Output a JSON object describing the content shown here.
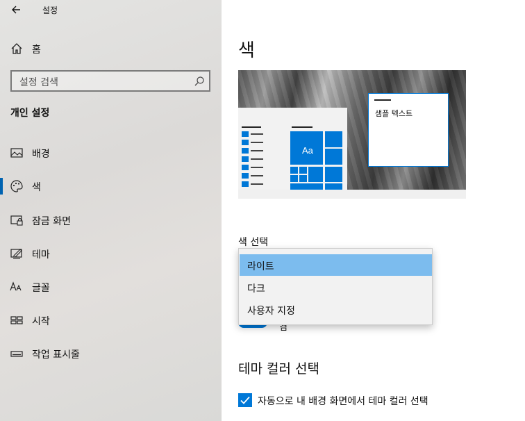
{
  "window": {
    "title": "설정",
    "back_icon": "arrow-left-icon"
  },
  "sidebar": {
    "home_label": "홈",
    "search_placeholder": "설정 검색",
    "section_title": "개인 설정",
    "items": [
      {
        "label": "배경",
        "icon": "picture-icon"
      },
      {
        "label": "색",
        "icon": "palette-icon",
        "active": true
      },
      {
        "label": "잠금 화면",
        "icon": "lock-screen-icon"
      },
      {
        "label": "테마",
        "icon": "theme-icon"
      },
      {
        "label": "글꼴",
        "icon": "font-icon"
      },
      {
        "label": "시작",
        "icon": "start-icon"
      },
      {
        "label": "작업 표시줄",
        "icon": "taskbar-icon"
      }
    ]
  },
  "main": {
    "page_title": "색",
    "preview": {
      "tile_text": "Aa",
      "sample_text": "샘플 텍스트"
    },
    "color_select_label": "색 선택",
    "dropdown_options": [
      "라이트",
      "다크",
      "사용자 지정"
    ],
    "dropdown_selected_index": 0,
    "toggle_hint_text": "켬",
    "theme_color_title": "테마 컬러 선택",
    "auto_color_checkbox": {
      "label": "자동으로 내 배경 화면에서 테마 컬러 선택",
      "checked": true
    }
  },
  "colors": {
    "accent": "#0078d7",
    "selected_option": "#7cbcee",
    "sidebar_active": "#0063b1"
  }
}
